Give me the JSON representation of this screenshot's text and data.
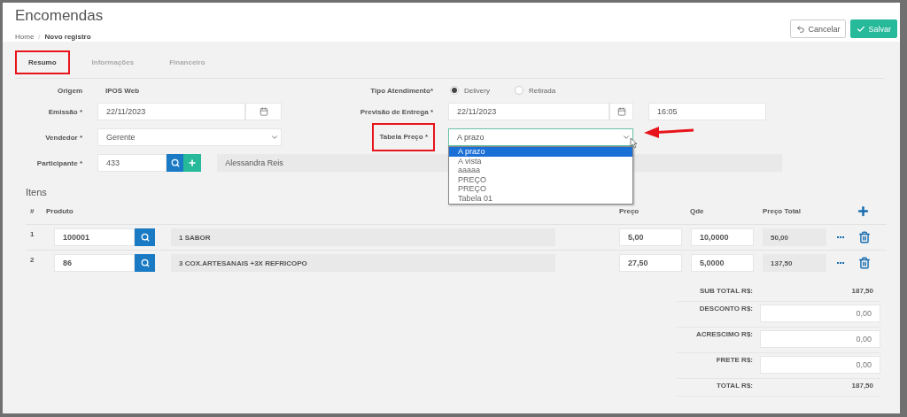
{
  "header": {
    "title": "Encomendas",
    "breadcrumb": [
      "Home",
      "Novo registro"
    ],
    "breadcrumb_separator": "/"
  },
  "actions": [
    {
      "label": "Cancelar",
      "kind": "cancel"
    },
    {
      "label": "Salvar",
      "kind": "save"
    }
  ],
  "tabs": [
    {
      "label": "Resumo",
      "selected": true,
      "highlighted": true
    },
    {
      "label": "Informações",
      "selected": false,
      "highlighted": false
    },
    {
      "label": "Financeiro",
      "selected": false,
      "highlighted": false
    }
  ],
  "form": {
    "origem": {
      "label": "Origem",
      "value": "IPOS Web"
    },
    "tipo_atendimento": {
      "label": "Tipo Atendimento*",
      "options": [
        {
          "label": "Delivery",
          "selected": true
        },
        {
          "label": "Retirada",
          "selected": false
        }
      ]
    },
    "emissao": {
      "label": "Emissão *",
      "value": "22/11/2023"
    },
    "previsao_entrega": {
      "label": "Previsão de Entrega *",
      "date": "22/11/2023",
      "time": "16:05"
    },
    "vendedor": {
      "label": "Vendedor *",
      "value": "Gerente"
    },
    "tabela_preco": {
      "label": "Tabela Preço *",
      "value": "A prazo",
      "highlighted": true,
      "open": true,
      "options": [
        {
          "label": "A prazo",
          "selected": true
        },
        {
          "label": "A vista",
          "selected": false
        },
        {
          "label": "aaaaa",
          "selected": false
        },
        {
          "label": "PREÇO",
          "selected": false
        },
        {
          "label": "PREÇO",
          "selected": false
        },
        {
          "label": "Tabela 01",
          "selected": false
        }
      ]
    },
    "participante": {
      "label": "Participante *",
      "code": "433",
      "name": "Alessandra Reis"
    }
  },
  "annotation_arrow": true,
  "items": {
    "title": "Itens",
    "columns": [
      "#",
      "Produto",
      "Preço",
      "Qde",
      "Preço Total"
    ],
    "rows": [
      {
        "index": "1",
        "code": "100001",
        "description": "1 SABOR",
        "price": "5,00",
        "qty": "10,0000",
        "total": "50,00"
      },
      {
        "index": "2",
        "code": "86",
        "description": "3 COX.ARTESANAIS +3X REFRICOPO",
        "price": "27,50",
        "qty": "5,0000",
        "total": "137,50"
      }
    ]
  },
  "totals": [
    {
      "kind": "text",
      "label": "SUB TOTAL R$:",
      "value": "187,50"
    },
    {
      "kind": "input",
      "label": "DESCONTO R$:",
      "value": "0,00"
    },
    {
      "kind": "input",
      "label": "ACRESCIMO R$:",
      "value": "0,00"
    },
    {
      "kind": "input",
      "label": "FRETE R$:",
      "value": "0,00"
    },
    {
      "kind": "text",
      "label": "TOTAL R$:",
      "value": "187,50"
    }
  ]
}
